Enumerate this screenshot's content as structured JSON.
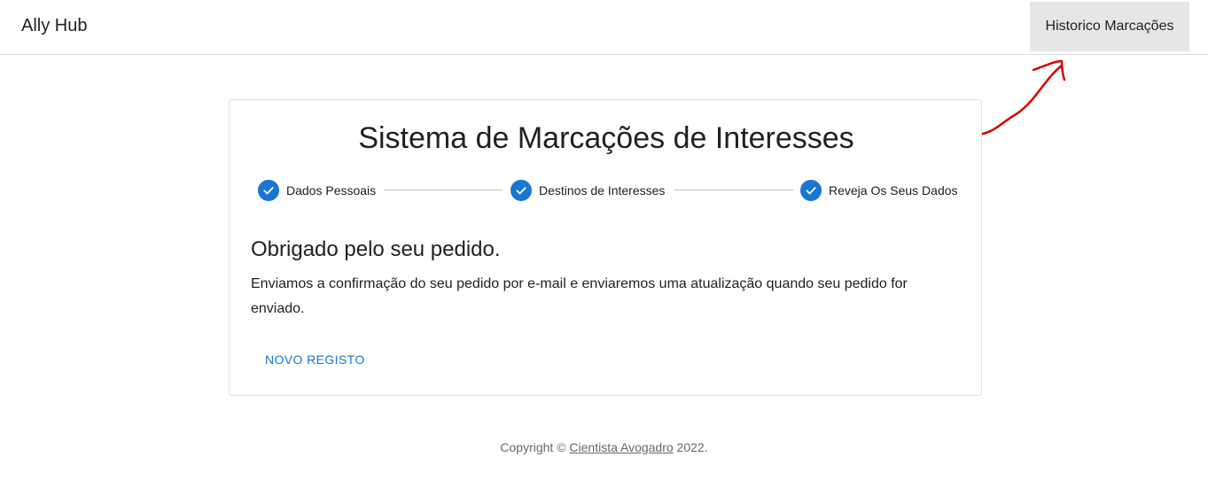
{
  "header": {
    "brand": "Ally Hub",
    "history_button": "Historico Marcações"
  },
  "card": {
    "title": "Sistema de Marcações de Interesses",
    "steps": [
      {
        "label": "Dados Pessoais",
        "status": "completed"
      },
      {
        "label": "Destinos de Interesses",
        "status": "completed"
      },
      {
        "label": "Reveja Os Seus Dados",
        "status": "completed"
      }
    ],
    "heading": "Obrigado pelo seu pedido.",
    "body": "Enviamos a confirmação do seu pedido por e-mail e enviaremos uma atualização quando seu pedido for enviado.",
    "new_button": "NOVO REGISTO"
  },
  "footer": {
    "prefix": "Copyright © ",
    "link": "Cientista Avogadro",
    "suffix": " 2022."
  },
  "colors": {
    "primary": "#1976d2",
    "annotation": "#d50000",
    "nav_button_bg": "#e6e6e9"
  },
  "icons": [
    "check-circle-icon"
  ]
}
